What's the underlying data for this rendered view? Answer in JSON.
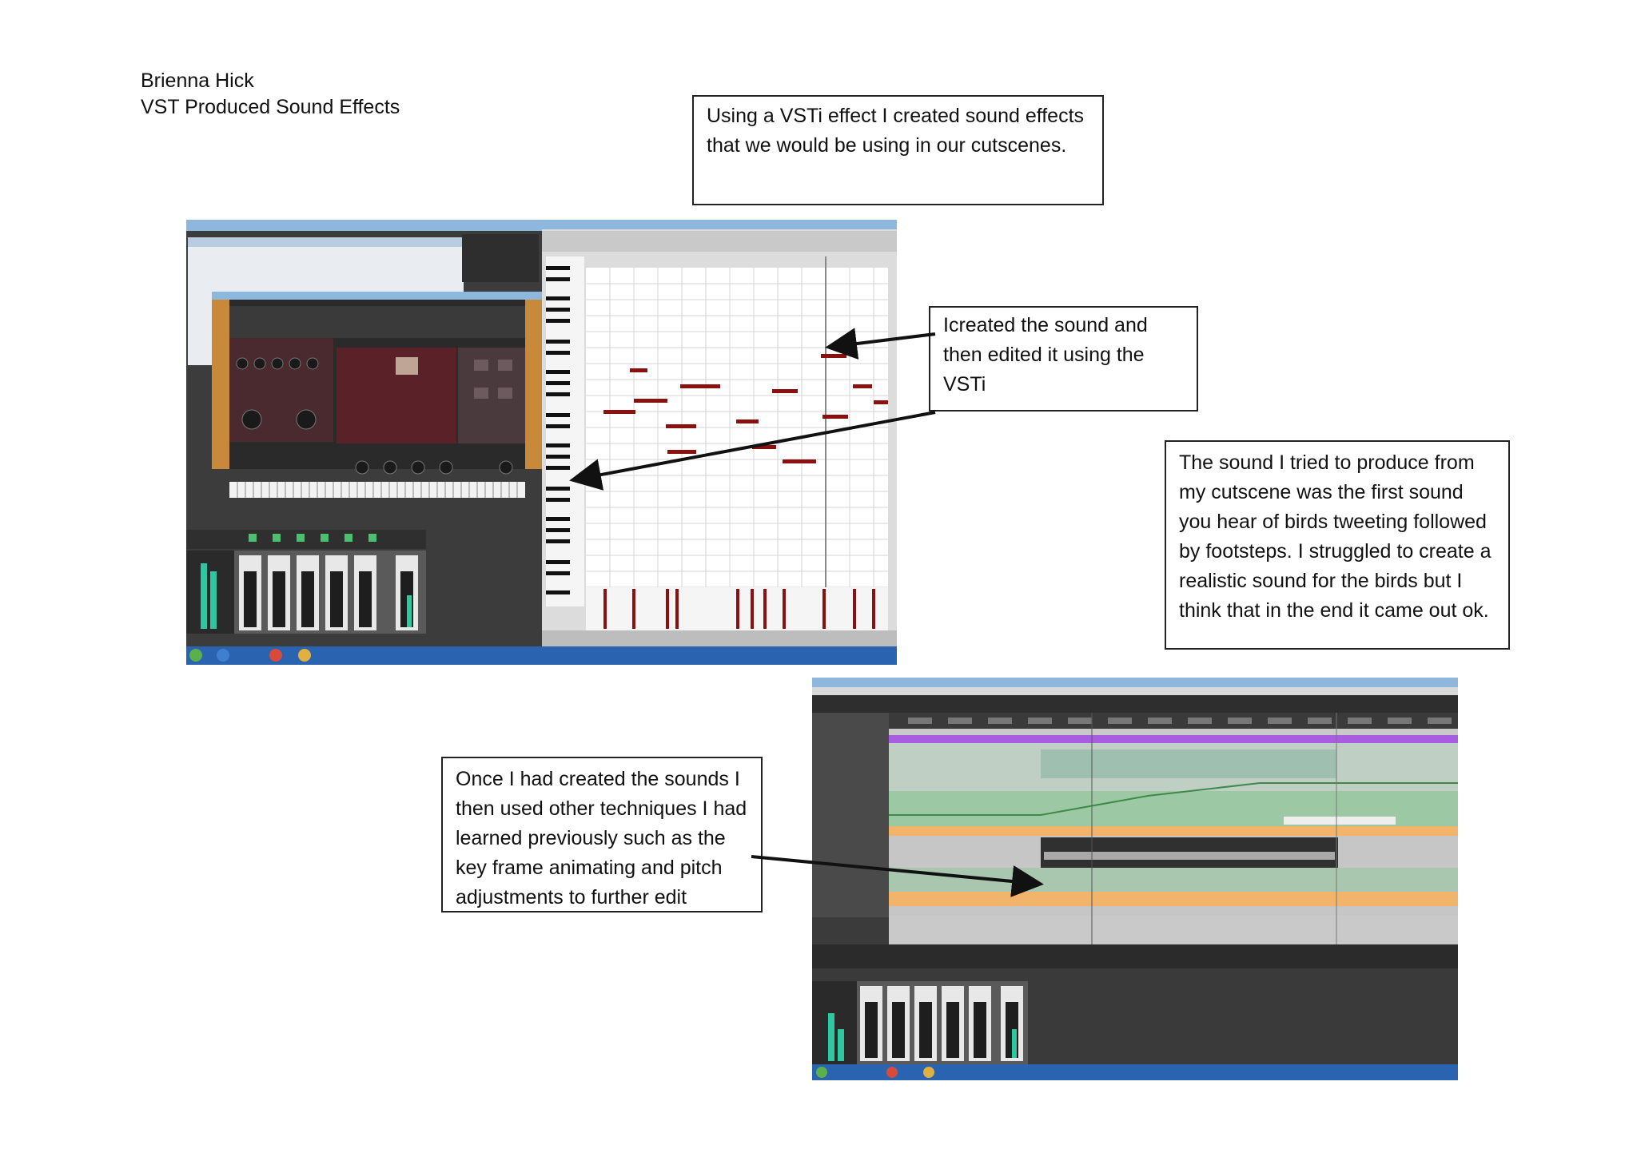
{
  "header": {
    "author": "Brienna Hick",
    "title": "VST Produced Sound Effects"
  },
  "notes": {
    "intro": [
      "Using a  VSTi effect I created sound effects",
      "that we would be using in our cutscenes."
    ],
    "created": [
      "Icreated the sound and",
      "then edited it using the",
      "VSTi"
    ],
    "sound": [
      "The sound I tried to produce from",
      "my cutscene was the first sound",
      "you hear of birds tweeting followed",
      "by footsteps. I struggled to create a",
      "realistic sound for the birds but I",
      "think that in the end it came out ok."
    ],
    "techniques": [
      "Once I had created the sounds I",
      "then used other techniques I had",
      "learned previously such as the",
      "key frame animating and pitch",
      "adjustments to further edit"
    ]
  },
  "colors": {
    "midi_note": "#8b1010",
    "plugin_panel": "#5a2228",
    "wood": "#c8893a",
    "automation_green": "#9cc9a3",
    "track_purple": "#a85ce0",
    "envelope_orange": "#f2b46a",
    "taskbar_blue": "#2a64b0"
  }
}
